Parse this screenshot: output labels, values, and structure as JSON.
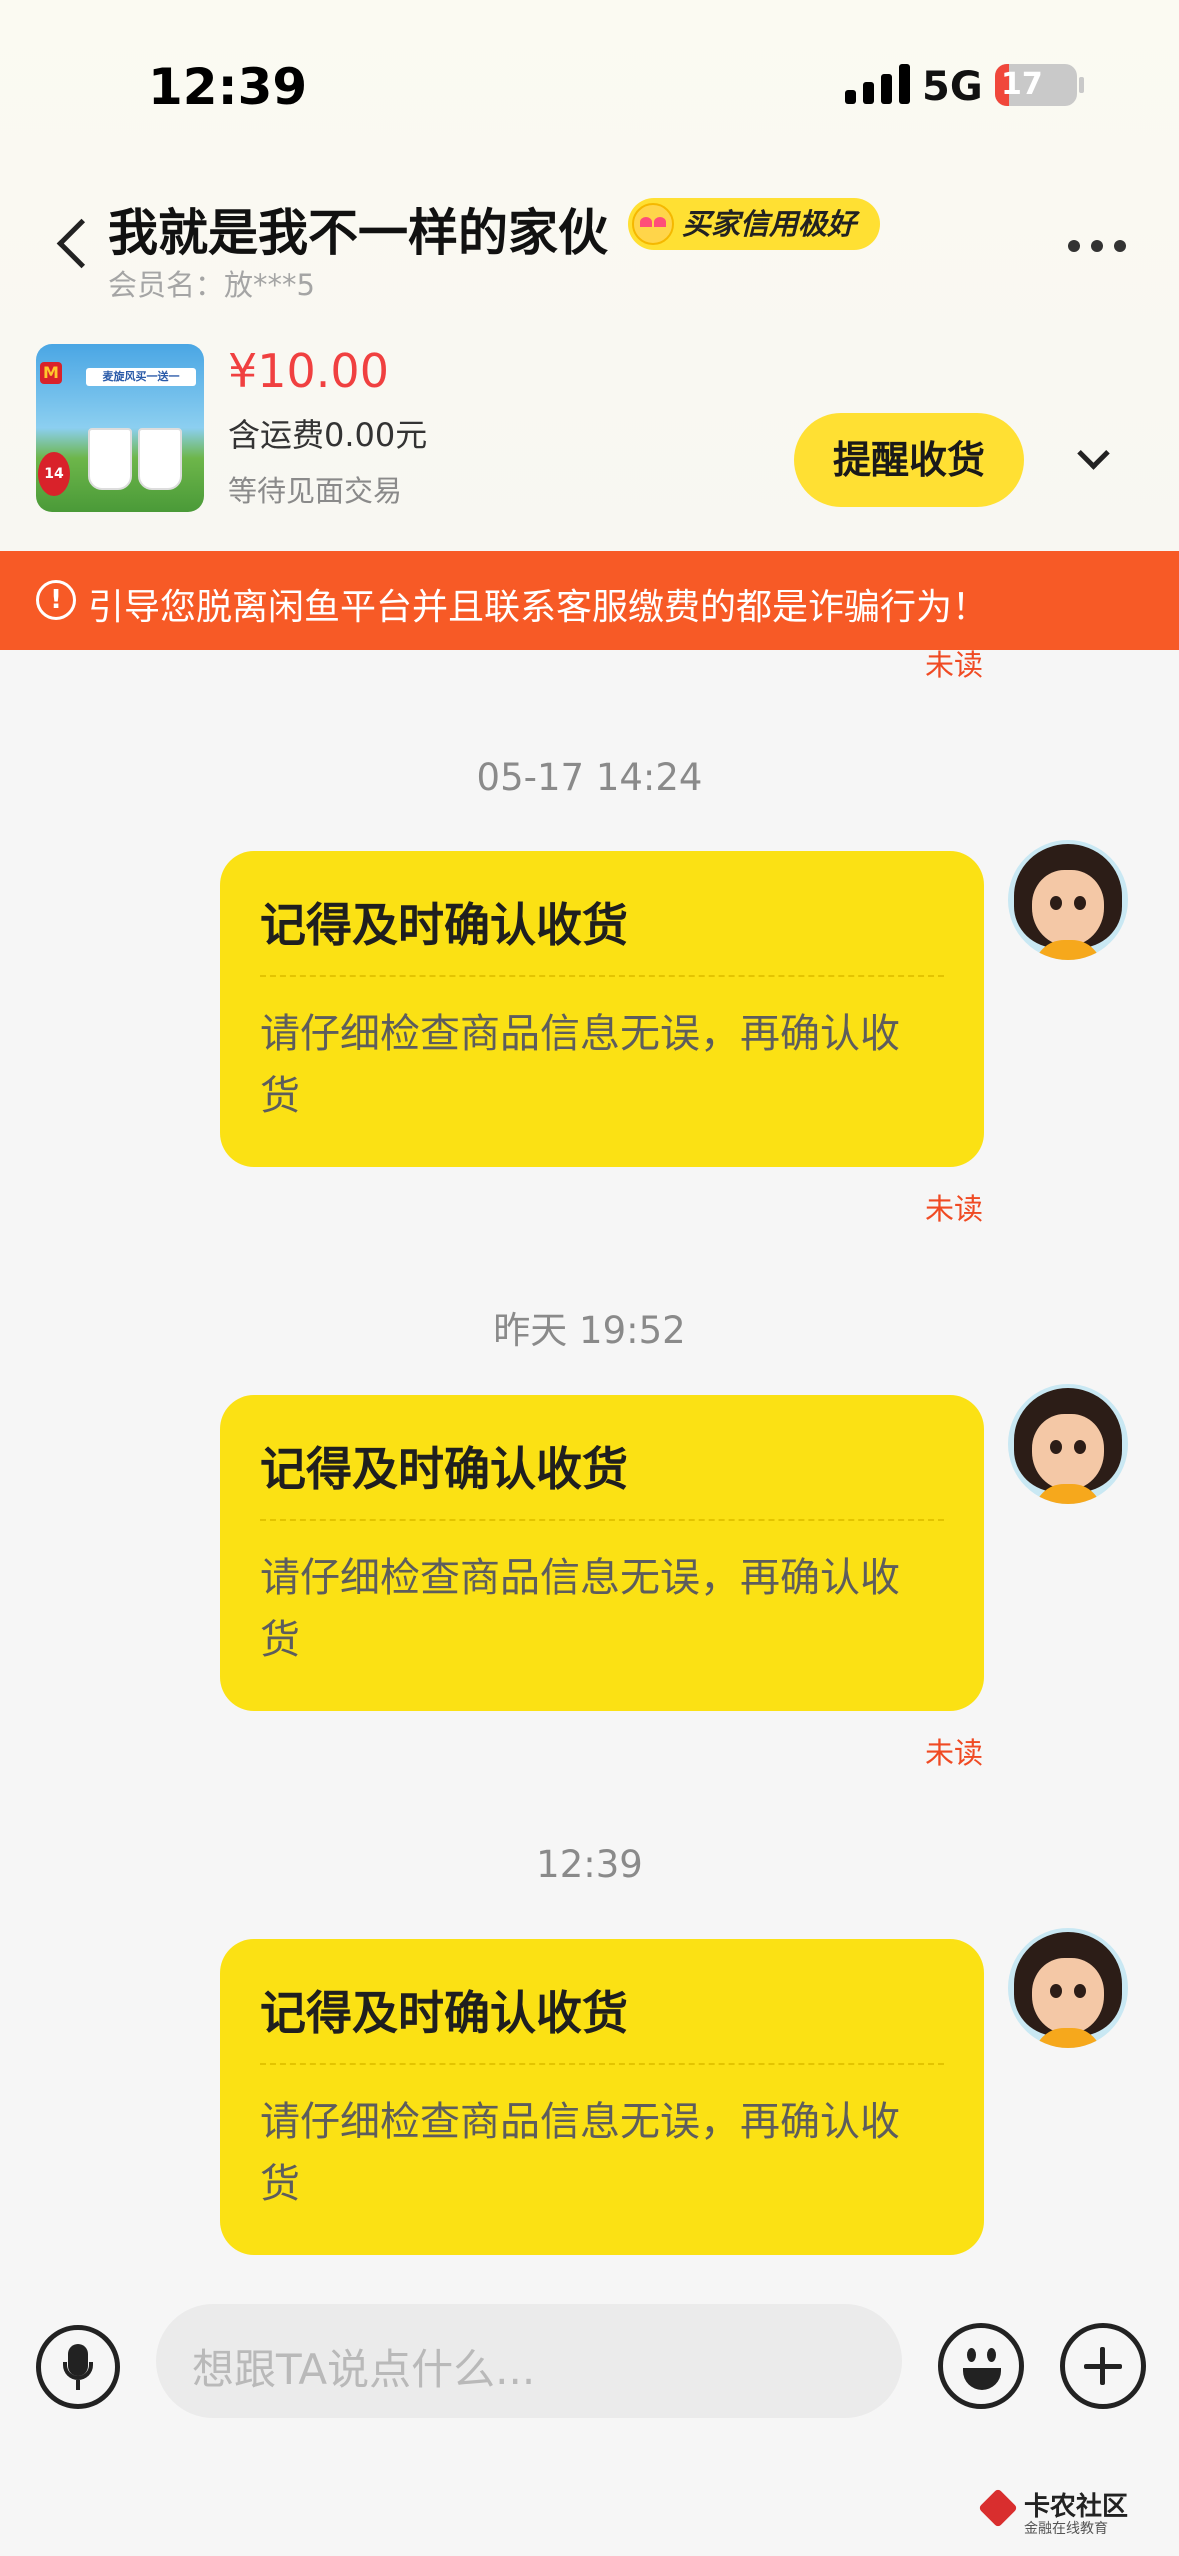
{
  "status_bar": {
    "time": "12:39",
    "network": "5G",
    "battery": "17",
    "battery_level_percent": 17
  },
  "header": {
    "back_icon": "chevron-left-icon",
    "title": "我就是我不一样的家伙",
    "badge_text": "买家信用极好",
    "badge_icon": "heart-eyes-emoji-icon",
    "member_label": "会员名：放***5",
    "more_icon": "more-dots-icon"
  },
  "product": {
    "image_text": {
      "banner": "麦旋风买一送一",
      "number": "14",
      "logo": "M"
    },
    "price": "¥10.00",
    "shipping": "含运费0.00元",
    "status": "等待见面交易",
    "remind_button": "提醒收货",
    "expand_icon": "chevron-down-icon"
  },
  "warning": {
    "icon": "exclamation-circle-icon",
    "text": "引导您脱离闲鱼平台并且联系客服缴费的都是诈骗行为！"
  },
  "chat": {
    "top_unread": "未读",
    "messages": [
      {
        "timestamp": "05-17 14:24",
        "title": "记得及时确认收货",
        "body": "请仔细检查商品信息无误，再确认收货",
        "status": "未读"
      },
      {
        "timestamp": "昨天 19:52",
        "title": "记得及时确认收货",
        "body": "请仔细检查商品信息无误，再确认收货",
        "status": "未读"
      },
      {
        "timestamp": "12:39",
        "title": "记得及时确认收货",
        "body": "请仔细检查商品信息无误，再确认收货",
        "status": ""
      }
    ]
  },
  "input_bar": {
    "voice_icon": "microphone-icon",
    "placeholder": "想跟TA说点什么...",
    "emoji_icon": "smiley-icon",
    "plus_icon": "plus-circle-icon"
  },
  "watermark": {
    "title": "卡农社区",
    "subtitle": "金融在线教育"
  },
  "colors": {
    "accent_yellow": "#fbe114",
    "warning_orange": "#f75a26",
    "price_red": "#f04040",
    "unread_red": "#f04a23"
  }
}
